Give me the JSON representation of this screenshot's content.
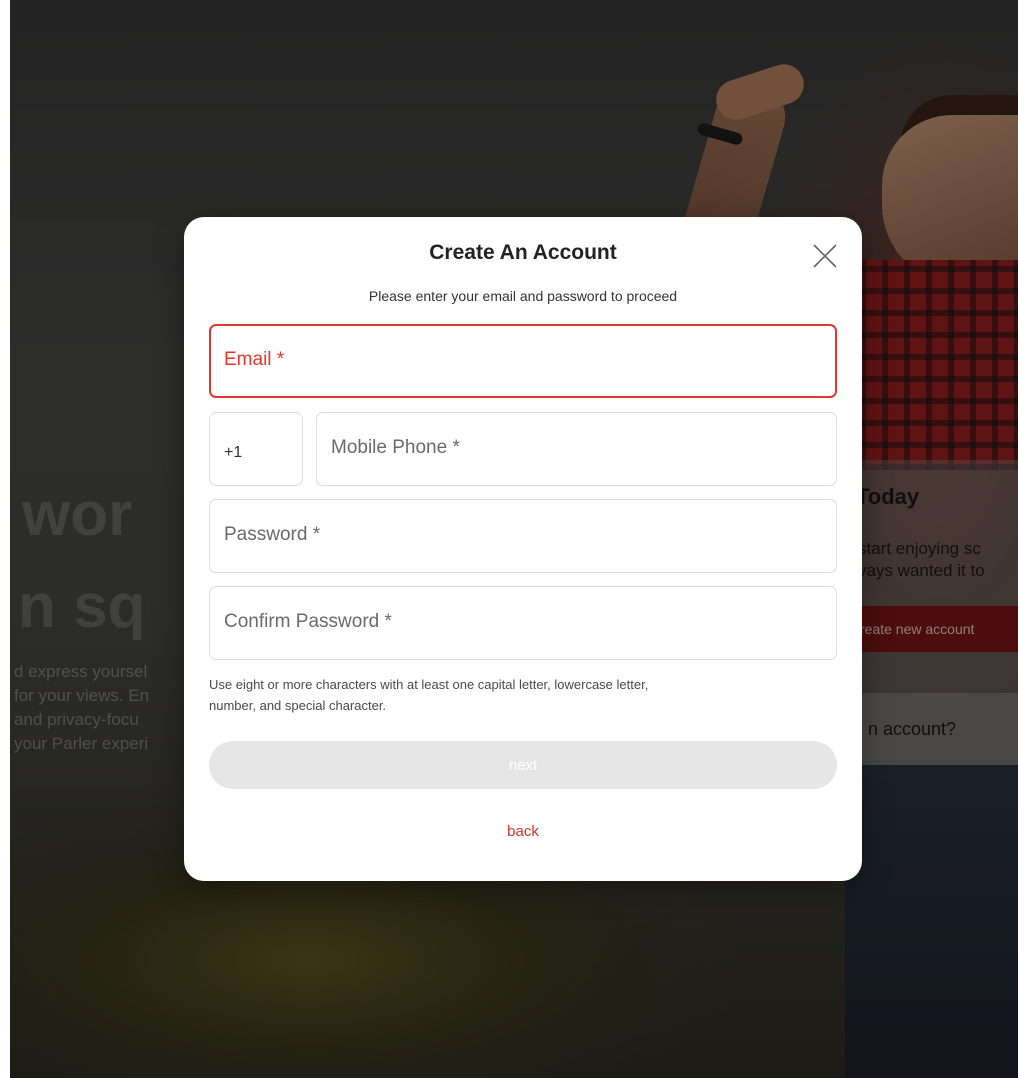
{
  "background": {
    "hero_line_1": "wor",
    "hero_line_2": "n sq",
    "hero_paragraph": [
      "d express yoursel",
      " for your views. En",
      " and privacy-focu",
      "your Parler experi"
    ],
    "side_card": {
      "title": "Today",
      "description_1": "start enjoying sc",
      "description_2": "vays wanted it to",
      "create_button": "reate new account",
      "account_prompt": "n account?"
    }
  },
  "modal": {
    "title": "Create An Account",
    "subtitle": "Please enter your email and password to proceed",
    "email_label": "Email *",
    "country_code": "+1",
    "phone_label": "Mobile Phone *",
    "password_label": "Password *",
    "confirm_label": "Confirm Password *",
    "hint_line_1": "Use eight or more characters with at least one capital letter, lowercase letter,",
    "hint_line_2": "number, and special character.",
    "next_label": "next",
    "back_label": "back"
  },
  "colors": {
    "accent": "#e2372f",
    "disabled_button": "#e6e6e6"
  }
}
